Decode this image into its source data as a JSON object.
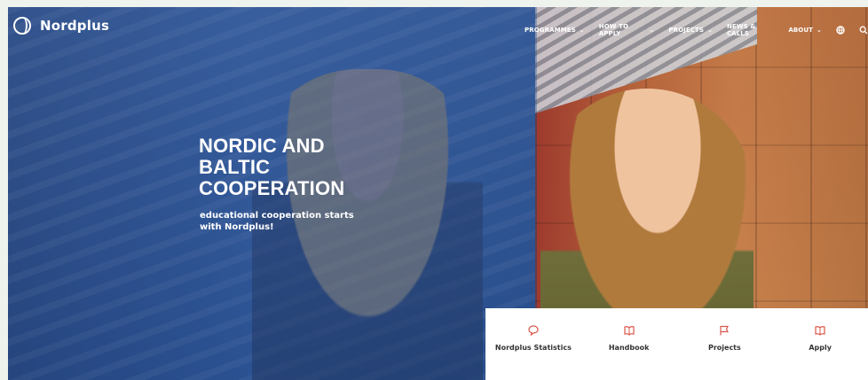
{
  "brand": {
    "name": "Nordplus"
  },
  "nav": {
    "items": [
      {
        "label": "PROGRAMMES",
        "has_dropdown": true
      },
      {
        "label": "HOW TO APPLY",
        "has_dropdown": true
      },
      {
        "label": "PROJECTS",
        "has_dropdown": true
      },
      {
        "label": "NEWS & CALLS",
        "has_dropdown": false
      },
      {
        "label": "ABOUT",
        "has_dropdown": true
      }
    ],
    "icons": [
      "globe-icon",
      "search-icon"
    ]
  },
  "hero": {
    "title": "NORDIC AND BALTIC COOPERATION",
    "subtitle": "educational cooperation starts with Nordplus!"
  },
  "quick_links": [
    {
      "label": "Nordplus Statistics",
      "icon": "chat-bubble-icon"
    },
    {
      "label": "Handbook",
      "icon": "book-icon"
    },
    {
      "label": "Projects",
      "icon": "flag-icon"
    },
    {
      "label": "Apply",
      "icon": "book-icon"
    }
  ],
  "colors": {
    "accent": "#d9574a",
    "overlay_blue": "#2b4f86",
    "text_light": "#ffffff"
  }
}
